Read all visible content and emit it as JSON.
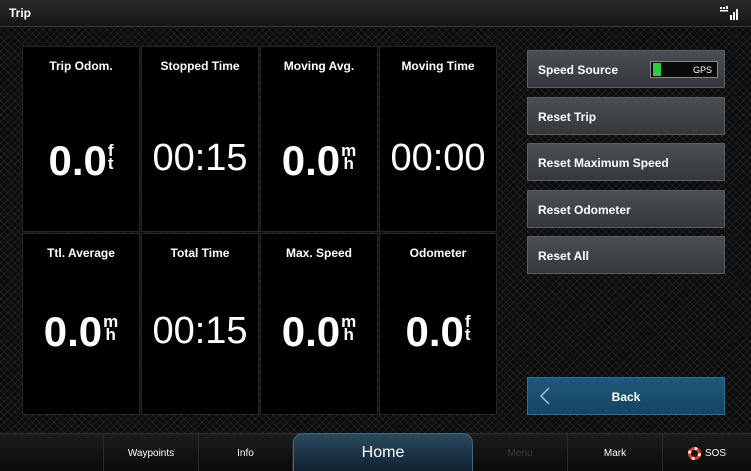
{
  "titlebar": {
    "title": "Trip",
    "status_icon": "gps-signal-icon"
  },
  "tiles": [
    {
      "label": "Trip Odom.",
      "value": "0.0",
      "unit_top": "f",
      "unit_bottom": "t",
      "kind": "big"
    },
    {
      "label": "Stopped Time",
      "value": "00:15",
      "kind": "time"
    },
    {
      "label": "Moving Avg.",
      "value": "0.0",
      "unit_top": "m",
      "unit_bottom": "h",
      "kind": "big"
    },
    {
      "label": "Moving Time",
      "value": "00:00",
      "kind": "time"
    },
    {
      "label": "Ttl. Average",
      "value": "0.0",
      "unit_top": "m",
      "unit_bottom": "h",
      "kind": "big"
    },
    {
      "label": "Total Time",
      "value": "00:15",
      "kind": "time"
    },
    {
      "label": "Max. Speed",
      "value": "0.0",
      "unit_top": "m",
      "unit_bottom": "h",
      "kind": "big"
    },
    {
      "label": "Odometer",
      "value": "0.0",
      "unit_top": "f",
      "unit_bottom": "t",
      "kind": "big"
    }
  ],
  "side_buttons": {
    "speed_source": {
      "label": "Speed Source",
      "toggle_value": "GPS",
      "toggle_color": "#2ecc40"
    },
    "reset_trip": "Reset Trip",
    "reset_max_speed": "Reset Maximum Speed",
    "reset_odometer": "Reset Odometer",
    "reset_all": "Reset All",
    "back": "Back"
  },
  "bottombar": {
    "waypoints": "Waypoints",
    "info": "Info",
    "home": "Home",
    "menu": "Menu",
    "mark": "Mark",
    "sos": "SOS",
    "sos_color": "#e8392a"
  }
}
